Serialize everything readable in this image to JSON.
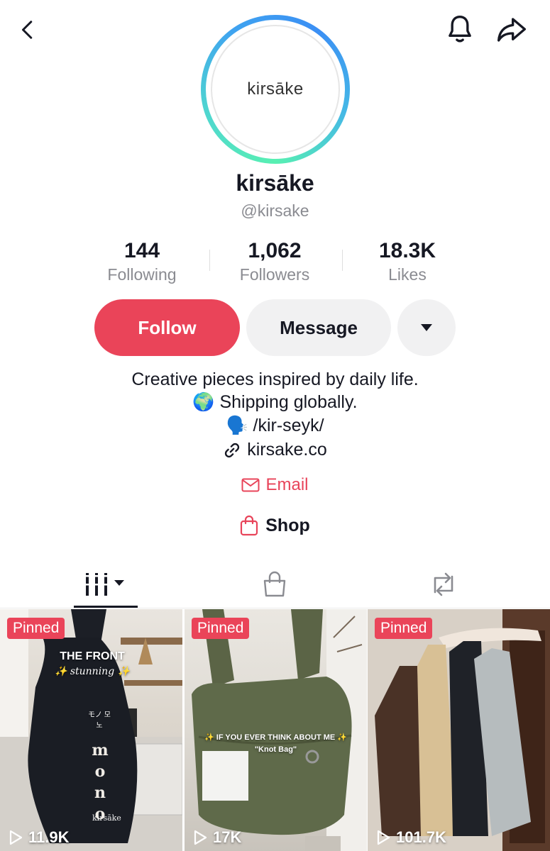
{
  "profile": {
    "avatar_text": "kirsāke",
    "display_name": "kirsāke",
    "username": "@kirsake"
  },
  "stats": {
    "following": {
      "value": "144",
      "label": "Following"
    },
    "followers": {
      "value": "1,062",
      "label": "Followers"
    },
    "likes": {
      "value": "18.3K",
      "label": "Likes"
    }
  },
  "actions": {
    "follow_label": "Follow",
    "message_label": "Message"
  },
  "bio": {
    "line1": "Creative pieces inspired by daily life.",
    "line2": "🌍 Shipping globally.",
    "line3": "🗣️ /kir-seyk/",
    "link": "kirsake.co",
    "email_label": "Email",
    "shop_label": "Shop"
  },
  "tabs": [
    {
      "name": "videos",
      "icon": "grid-icon",
      "active": true
    },
    {
      "name": "shop",
      "icon": "shopping-bag-icon",
      "active": false
    },
    {
      "name": "reposts",
      "icon": "repost-icon",
      "active": false
    }
  ],
  "videos": [
    {
      "badge": "Pinned",
      "views": "11.9K",
      "overlay_line1": "THE FRONT",
      "overlay_line2": "✨ stunning ✨",
      "bag_word": "mono",
      "bag_brand": "kirsāke",
      "bag_small": "モノ 모노"
    },
    {
      "badge": "Pinned",
      "views": "17K",
      "overlay_line1": "✨ IF YOU EVER THINK ABOUT ME ✨",
      "overlay_line2": "\"Knot Bag\""
    },
    {
      "badge": "Pinned",
      "views": "101.7K"
    }
  ],
  "colors": {
    "accent": "#ea4459",
    "text": "#161823",
    "secondary_text": "#8a8b91",
    "button_grey": "#f1f1f2"
  }
}
